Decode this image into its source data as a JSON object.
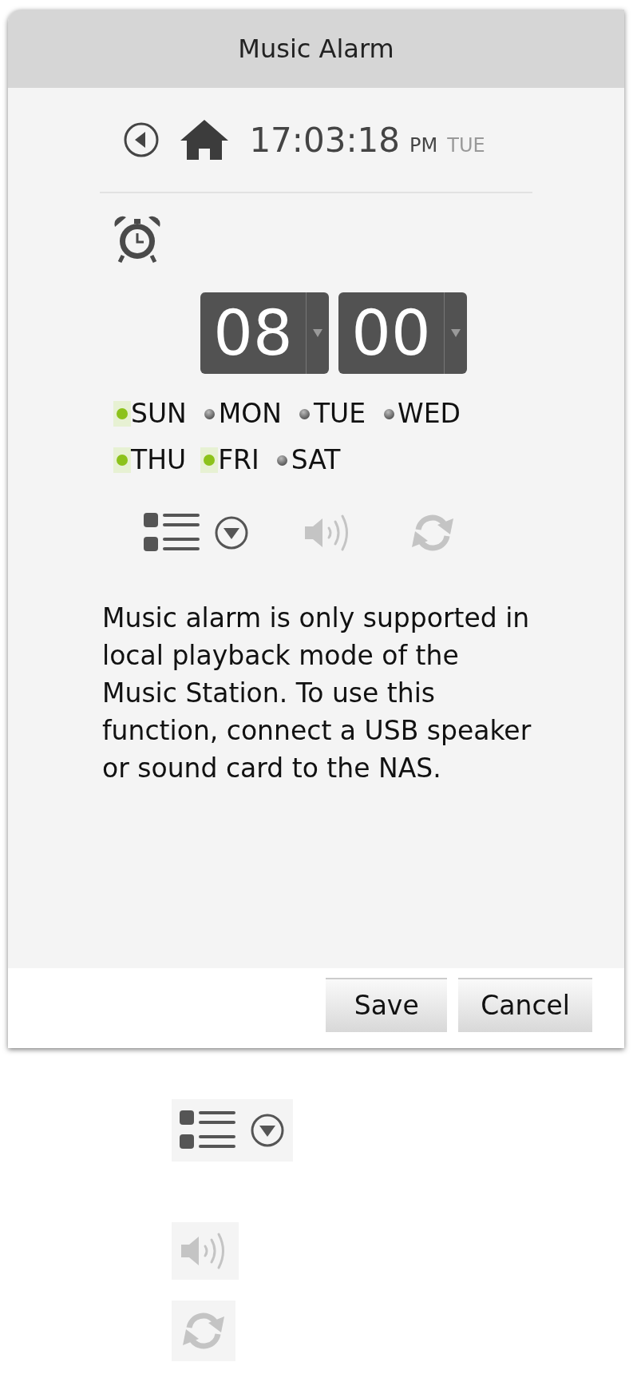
{
  "dialog": {
    "title": "Music Alarm"
  },
  "clock": {
    "time": "17:03:18",
    "meridiem": "PM",
    "weekday": "TUE"
  },
  "alarm": {
    "hour": "08",
    "minute": "00"
  },
  "days": [
    {
      "label": "SUN",
      "selected": true
    },
    {
      "label": "MON",
      "selected": false
    },
    {
      "label": "TUE",
      "selected": false
    },
    {
      "label": "WED",
      "selected": false
    },
    {
      "label": "THU",
      "selected": true
    },
    {
      "label": "FRI",
      "selected": true
    },
    {
      "label": "SAT",
      "selected": false
    }
  ],
  "tools": [
    {
      "kind": "playlist",
      "disabled": false
    },
    {
      "kind": "volume",
      "disabled": true
    },
    {
      "kind": "repeat",
      "disabled": true
    }
  ],
  "message": "Music alarm is only supported in local playback mode of the Music Station. To use this function, connect a USB speaker or sound card to the NAS.",
  "buttons": [
    "Save",
    "Cancel"
  ],
  "legend": [
    {
      "kind": "playlist",
      "disabled": false
    },
    {
      "kind": "volume",
      "disabled": true
    },
    {
      "kind": "repeat",
      "disabled": true
    }
  ]
}
